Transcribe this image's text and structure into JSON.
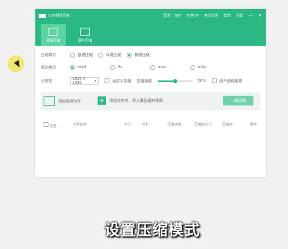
{
  "app": {
    "title": "CVR视频压缩",
    "window_links": [
      "登录｜注册",
      "开通VIP",
      "意见反馈",
      "帮助",
      "设置"
    ],
    "window_buttons": [
      "—",
      "✕"
    ],
    "modes": [
      {
        "label": "视频压缩",
        "active": true
      },
      {
        "label": "图片压缩",
        "active": false
      }
    ]
  },
  "settings": {
    "compress_mode_label": "压缩模式",
    "compress_mode_options": [
      "普通压缩",
      "深度压缩",
      "极限压缩"
    ],
    "output_format_label": "输出格式",
    "output_format_options": [
      "mp4",
      "flv",
      "mov",
      "mkv"
    ],
    "resolution_label": "分辨率",
    "resolution_value": "1920 × 1080",
    "custom_compress_label": "自定义压缩",
    "compress_intensity_label": "压缩强度",
    "compress_intensity_percent": 50,
    "compress_intensity_text": "50%",
    "improve_quality_label": "提升视频画质"
  },
  "toolbar": {
    "add_video_label": "添加视频文件",
    "add_folder_label": "添加文件夹，导入要压缩的视频",
    "compress_all_label": "一键压缩"
  },
  "table": {
    "headers": [
      "全选",
      "文件名称",
      "大小",
      "时长",
      "压缩进度",
      "压缩后大小",
      "压缩率",
      "操作"
    ]
  },
  "caption": "设置压缩模式"
}
